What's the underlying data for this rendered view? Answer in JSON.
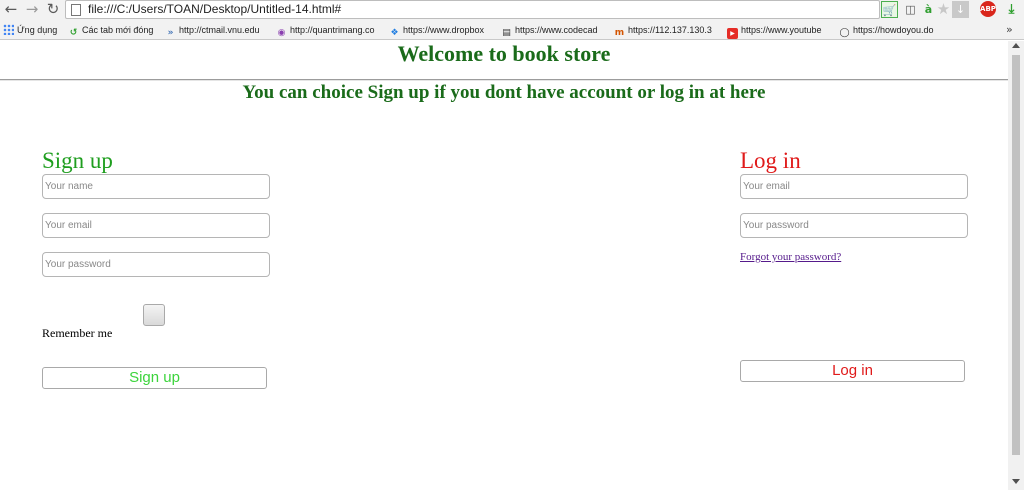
{
  "browser": {
    "url": "file:///C:/Users/TOAN/Desktop/Untitled-14.html#",
    "bookmarks": [
      "Ứng dụng",
      "Các tab mới đóng",
      "http://ctmail.vnu.edu",
      "http://quantrimang.co",
      "https://www.dropbox",
      "https://www.codecad",
      "https://112.137.130.3",
      "https://www.youtube",
      "https://howdoyou.do"
    ],
    "more_symbol": "»",
    "icons": [
      "back-icon",
      "forward-icon",
      "reload-icon",
      "page-icon",
      "cart-extension-icon",
      "translate-icon",
      "leaf-icon",
      "bookmark-star-icon",
      "download-arrow-icon",
      "adblock-icon",
      "download-icon"
    ]
  },
  "page": {
    "title": "Welcome to book store",
    "subtitle": "You can choice Sign up if you dont have account or log in at here",
    "signup": {
      "heading": "Sign up",
      "name_placeholder": "Your name",
      "email_placeholder": "Your email",
      "password_placeholder": "Your password",
      "remember_label": "Remember me",
      "remember_checked": false,
      "button_label": "Sign up"
    },
    "login": {
      "heading": "Log in",
      "email_placeholder": "Your email",
      "password_placeholder": "Your password",
      "forgot_label": "Forgot your password?",
      "button_label": "Log in"
    }
  },
  "colors": {
    "title": "#1a6b1a",
    "signup_accent": "#1f9e1f",
    "signup_button_text": "#3cd43c",
    "login_accent": "#e01a1a",
    "link": "#551a8b"
  }
}
